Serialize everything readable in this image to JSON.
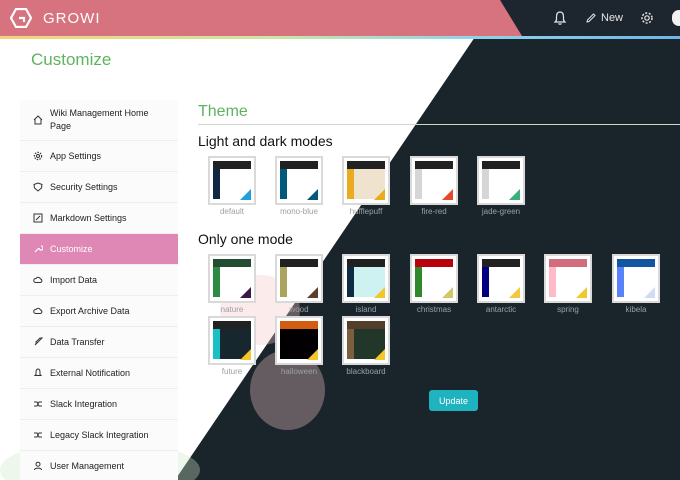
{
  "app": {
    "brand": "GROWI"
  },
  "header": {
    "new_label": "New",
    "icons": [
      "bell-icon",
      "pencil-icon",
      "gear-icon",
      "avatar"
    ]
  },
  "page": {
    "title": "Customize"
  },
  "sidebar": {
    "items": [
      {
        "label": "Wiki Management Home Page",
        "icon": "home-icon"
      },
      {
        "label": "App Settings",
        "icon": "gear-icon"
      },
      {
        "label": "Security Settings",
        "icon": "shield-icon"
      },
      {
        "label": "Markdown Settings",
        "icon": "pencil-icon"
      },
      {
        "label": "Customize",
        "icon": "wrench-icon",
        "active": true
      },
      {
        "label": "Import Data",
        "icon": "cloud-upload-icon"
      },
      {
        "label": "Export Archive Data",
        "icon": "cloud-download-icon"
      },
      {
        "label": "Data Transfer",
        "icon": "rocket-icon"
      },
      {
        "label": "External Notification",
        "icon": "bell-icon"
      },
      {
        "label": "Slack Integration",
        "icon": "shuffle-icon"
      },
      {
        "label": "Legacy Slack Integration",
        "icon": "shuffle-icon"
      },
      {
        "label": "User Management",
        "icon": "user-icon"
      }
    ]
  },
  "theme": {
    "section_title": "Theme",
    "light_dark_heading": "Light and dark modes",
    "one_mode_heading": "Only one mode",
    "light_dark_themes": [
      {
        "name": "default",
        "top": "#212121",
        "side": "#112744",
        "body": "#ffffff",
        "accent": "#209fd8"
      },
      {
        "name": "mono-blue",
        "top": "#212121",
        "side": "#00587a",
        "body": "#ffffff",
        "accent": "#00587a"
      },
      {
        "name": "hufflepuff",
        "top": "#212121",
        "side": "#eaab20",
        "body": "#efe2cf",
        "accent": "#eaab20"
      },
      {
        "name": "fire-red",
        "top": "#212121",
        "side": "#d6d6d6",
        "body": "#ffffff",
        "accent": "#e7482c"
      },
      {
        "name": "jade-green",
        "top": "#212121",
        "side": "#d6d6d6",
        "body": "#ffffff",
        "accent": "#3aae7c"
      }
    ],
    "one_mode_themes": [
      {
        "name": "nature",
        "top": "#234d33",
        "side": "#2d8a43",
        "body": "#ffffff",
        "accent": "#3b1849"
      },
      {
        "name": "wood",
        "top": "#212121",
        "side": "#aaa45f",
        "body": "#ffffff",
        "accent": "#5e3f2b"
      },
      {
        "name": "island",
        "top": "#212121",
        "side": "#102a44",
        "body": "#cef1f1",
        "accent": "#f4c62a"
      },
      {
        "name": "christmas",
        "top": "#b8010c",
        "side": "#30882c",
        "body": "#ffffff",
        "accent": "#d3c665"
      },
      {
        "name": "antarctic",
        "top": "#212121",
        "side": "#000080",
        "body": "#ffffff",
        "accent": "#f5c642"
      },
      {
        "name": "spring",
        "top": "#d36d7e",
        "side": "#ffb9c8",
        "body": "#ffffff",
        "accent": "#f4c62a"
      },
      {
        "name": "kibela",
        "top": "#1256a3",
        "side": "#5882fa",
        "body": "#ffffff",
        "accent": "#d0dcf5"
      },
      {
        "name": "future",
        "top": "#212121",
        "side": "#1bbfc6",
        "body": "#16282d",
        "accent": "#f4c62a"
      },
      {
        "name": "halloween",
        "top": "#d35c11",
        "side": "#000000",
        "body": "#030003",
        "accent": "#f4c62a"
      },
      {
        "name": "blackboard",
        "top": "#523f2a",
        "side": "#7c5f3e",
        "body": "#223729",
        "accent": "#f4c62a"
      }
    ],
    "update_label": "Update"
  },
  "colors": {
    "accent_green": "#5fb35f",
    "active_pink": "#df88b5",
    "button_teal": "#1fb3bf",
    "dark_bg": "#1a242b"
  }
}
